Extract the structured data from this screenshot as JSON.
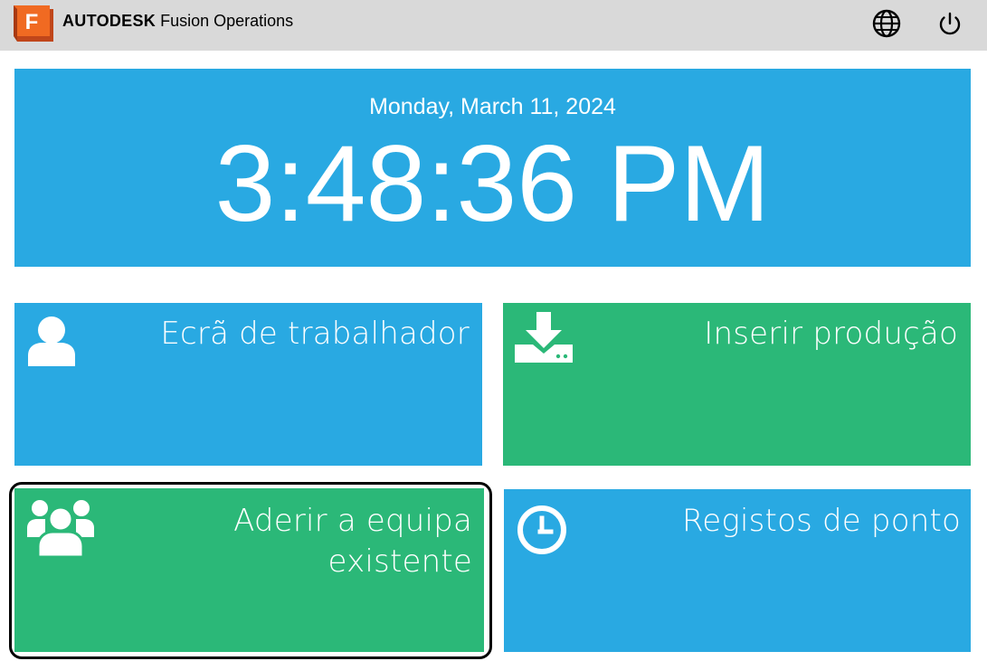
{
  "header": {
    "brand_bold": "AUTODESK",
    "brand_product": "Fusion Operations",
    "logo_letter": "F",
    "language_icon": "globe-icon",
    "power_icon": "power-icon"
  },
  "clock": {
    "date": "Monday, March 11, 2024",
    "time": "3:48:36 PM"
  },
  "tiles": [
    {
      "label": "Ecrã de trabalhador",
      "icon": "user-icon",
      "color": "#29a9e2"
    },
    {
      "label": "Inserir produção",
      "icon": "download-tray-icon",
      "color": "#2bb878"
    },
    {
      "label_line1": "Aderir a equipa",
      "label_line2": "existente",
      "icon": "team-icon",
      "color": "#2bb878",
      "focused": true
    },
    {
      "label": "Registos de ponto",
      "icon": "clock-icon",
      "color": "#29a9e2"
    }
  ],
  "colors": {
    "header_bg": "#d9d9d9",
    "blue": "#29a9e2",
    "green": "#2bb878",
    "logo_orange": "#f06a22"
  }
}
